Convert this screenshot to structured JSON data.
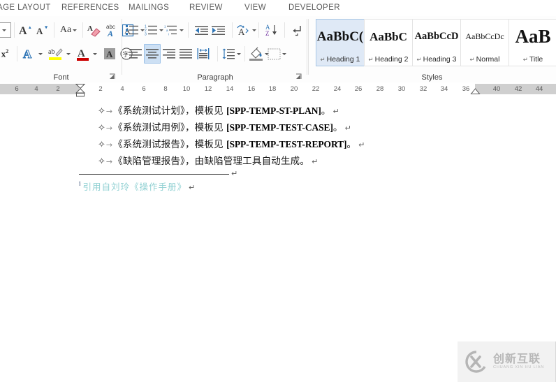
{
  "window": {
    "app": "Word Ribbon",
    "tabs": [
      {
        "label": "AGE LAYOUT",
        "active": false
      },
      {
        "label": "REFERENCES",
        "active": false
      },
      {
        "label": "MAILINGS",
        "active": false
      },
      {
        "label": "REVIEW",
        "active": false
      },
      {
        "label": "VIEW",
        "active": false
      },
      {
        "label": "DEVELOPER",
        "active": false
      }
    ]
  },
  "ribbon": {
    "groups": [
      {
        "id": "font",
        "label": "Font",
        "dialog_launcher": "⌐"
      },
      {
        "id": "paragraph",
        "label": "Paragraph",
        "dialog_launcher": "⌐"
      },
      {
        "id": "styles",
        "label": "Styles"
      }
    ],
    "font_group": {
      "row1": [
        {
          "name": "font-size-dropdown",
          "icon": "chevron-down-icon",
          "label": ""
        },
        {
          "name": "grow-font-button",
          "icon": "grow-font-icon",
          "label": "A"
        },
        {
          "name": "shrink-font-button",
          "icon": "shrink-font-icon",
          "label": "A"
        },
        {
          "name": "change-case-button",
          "icon": "change-case-icon",
          "label": "Aa"
        },
        {
          "name": "clear-formatting-button",
          "icon": "clear-formatting-icon",
          "label": ""
        },
        {
          "name": "phonetic-guide-button",
          "icon": "phonetic-guide-icon",
          "label": "abc"
        },
        {
          "name": "character-border-button",
          "icon": "character-border-icon",
          "label": "A"
        }
      ],
      "row2": [
        {
          "name": "superscript-button",
          "icon": "superscript-icon",
          "label": "x²"
        },
        {
          "name": "text-effects-button",
          "icon": "text-effects-icon",
          "label": "A"
        },
        {
          "name": "text-highlight-color-button",
          "icon": "highlight-icon",
          "label": "ab"
        },
        {
          "name": "font-color-button",
          "icon": "font-color-icon",
          "label": "A"
        },
        {
          "name": "character-shading-button",
          "icon": "character-shading-icon",
          "label": "A"
        },
        {
          "name": "enclose-characters-button",
          "icon": "enclose-characters-icon",
          "label": "字"
        }
      ]
    },
    "paragraph_group": {
      "row1": [
        {
          "name": "bullets-button",
          "icon": "bullet-list-icon"
        },
        {
          "name": "numbering-button",
          "icon": "numbered-list-icon"
        },
        {
          "name": "multilevel-list-button",
          "icon": "multilevel-list-icon"
        },
        {
          "name": "decrease-indent-button",
          "icon": "decrease-indent-icon"
        },
        {
          "name": "increase-indent-button",
          "icon": "increase-indent-icon"
        },
        {
          "name": "asian-layout-button",
          "icon": "asian-layout-icon"
        },
        {
          "name": "sort-button",
          "icon": "sort-az-icon"
        },
        {
          "name": "show-formatting-marks-button",
          "icon": "pilcrow-icon"
        }
      ],
      "row2": [
        {
          "name": "align-left-button",
          "icon": "align-left-icon",
          "active": false
        },
        {
          "name": "align-center-button",
          "icon": "align-center-icon",
          "active": true
        },
        {
          "name": "align-right-button",
          "icon": "align-right-icon",
          "active": false
        },
        {
          "name": "justify-button",
          "icon": "justify-icon",
          "active": false
        },
        {
          "name": "distribute-button",
          "icon": "distribute-icon",
          "active": false
        },
        {
          "name": "line-spacing-button",
          "icon": "line-spacing-icon",
          "active": false
        },
        {
          "name": "shading-button",
          "icon": "shading-icon",
          "active": false
        },
        {
          "name": "borders-button",
          "icon": "borders-icon",
          "active": false
        }
      ]
    },
    "styles_gallery": [
      {
        "preview": "AaBbC(",
        "name": "Heading 1",
        "active": true
      },
      {
        "preview": "AaBbC",
        "name": "Heading 2",
        "active": false
      },
      {
        "preview": "AaBbCcD",
        "name": "Heading 3",
        "active": false
      },
      {
        "preview": "AaBbCcDc",
        "name": "Normal",
        "active": false
      },
      {
        "preview": "AaB",
        "name": "Title",
        "active": false
      }
    ],
    "style_pilcrow": "↵"
  },
  "ruler": {
    "left_ticks": [
      "6",
      "4",
      "2"
    ],
    "right_ticks": [
      "2",
      "4",
      "6",
      "8",
      "10",
      "12",
      "14",
      "16",
      "18",
      "20",
      "22",
      "24",
      "26",
      "28",
      "30",
      "32",
      "34",
      "36"
    ],
    "far_right_ticks": [
      "40",
      "42",
      "44"
    ]
  },
  "document": {
    "bullet_glyph": "✧",
    "tab_glyph": "→",
    "paragraph_mark": "↵",
    "paragraphs": [
      {
        "cjk_before": "《系统测试计划》，模板见",
        "code": "[SPP-TEMP-ST-PLAN]",
        "cjk_after": "。"
      },
      {
        "cjk_before": "《系统测试用例》，模板见",
        "code": "[SPP-TEMP-TEST-CASE]",
        "cjk_after": "。"
      },
      {
        "cjk_before": "《系统测试报告》，模板见",
        "code": "[SPP-TEMP-TEST-REPORT]",
        "cjk_after": "。"
      },
      {
        "cjk_before": "《缺陷管理报告》，由缺陷管理工具自动生成。",
        "code": "",
        "cjk_after": ""
      }
    ],
    "footnote": {
      "separator_mark": "↵",
      "reference_mark": "i",
      "text": "引用自刘玲《操作手册》",
      "paragraph_mark": "↵"
    }
  },
  "watermark": {
    "monogram": "CX",
    "chinese": "创新互联",
    "pinyin": "CHUANG XIN HU LIAN"
  },
  "colors": {
    "accent_selection": "#cde0f4",
    "style_active": "#dfe9f6",
    "footnote_text": "#8fd0d2",
    "footnote_ref": "#1f3864",
    "ribbon_bg": "#fdfdfd",
    "ruler_margin": "#cfcfcf"
  }
}
